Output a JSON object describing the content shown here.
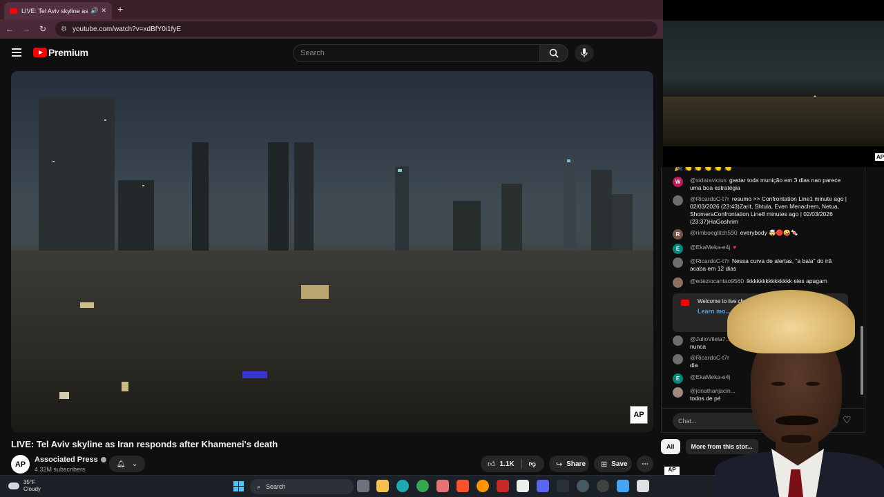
{
  "browser": {
    "tab_title": "LIVE: Tel Aviv skyline as Iran",
    "new_tab": "+",
    "url": "youtube.com/watch?v=xdBfY0i1fyE"
  },
  "header": {
    "logo_text": "Premium",
    "search_placeholder": "Search"
  },
  "video": {
    "title": "LIVE: Tel Aviv skyline as Iran responds after Khamenei's death",
    "watermark": "AP"
  },
  "channel": {
    "avatar_text": "AP",
    "name": "Associated Press",
    "subscribers": "4.32M subscribers"
  },
  "actions": {
    "like_count": "1.1K",
    "share_label": "Share",
    "save_label": "Save"
  },
  "chat": {
    "messages": [
      {
        "initial": "W",
        "color": "#c2185b",
        "author": "@sidaravicius",
        "text": "gastar toda munição em 3 dias nao parece uma boa estratégia"
      },
      {
        "initial": "",
        "color": "#6d6d6d",
        "author": "@RicardoC-t7r",
        "text": "resumo >> Confrontation Line1 minute ago | 02/03/2026 (23:43)Zarit, Shtula, Even Menachem, Netua, ShomeraConfrontation Line8 minutes ago | 02/03/2026 (23:37)HaGoshrim"
      },
      {
        "initial": "R",
        "color": "#795548",
        "author": "@rimboeglitch590",
        "text": "everybody"
      },
      {
        "initial": "E",
        "color": "#00897b",
        "author": "@EkaMeka-e4j",
        "text": ""
      },
      {
        "initial": "",
        "color": "#6d6d6d",
        "author": "@RicardoC-t7r",
        "text": "Nessa curva de alertas, \"a bala\" do irã acaba em 12 dias"
      },
      {
        "initial": "",
        "color": "#8d6e63",
        "author": "@edeziocantao9560",
        "text": "lkkkkkkkkkkkkkkk eles apagam"
      }
    ],
    "welcome_text": "Welcome to live ch... and abide by o...",
    "welcome_link": "Learn mo...",
    "later_messages": [
      {
        "initial": "",
        "color": "#6d6d6d",
        "author": "@JulioVilela7...",
        "text": "nunca"
      },
      {
        "initial": "",
        "color": "#6d6d6d",
        "author": "@RicardoC-t7r",
        "text": "dia"
      },
      {
        "initial": "E",
        "color": "#00897b",
        "author": "@EkaMeka-e4j",
        "text": ""
      },
      {
        "initial": "",
        "color": "#a1887f",
        "author": "@jonathanjacin...",
        "text": "todos de pé"
      }
    ],
    "input_placeholder": "Chat..."
  },
  "chips": {
    "all": "All",
    "more_from": "More from this stor..."
  },
  "mini_video": {
    "watermark": "AP"
  },
  "taskbar": {
    "temperature": "35°F",
    "condition": "Cloudy",
    "search_label": "Search"
  }
}
